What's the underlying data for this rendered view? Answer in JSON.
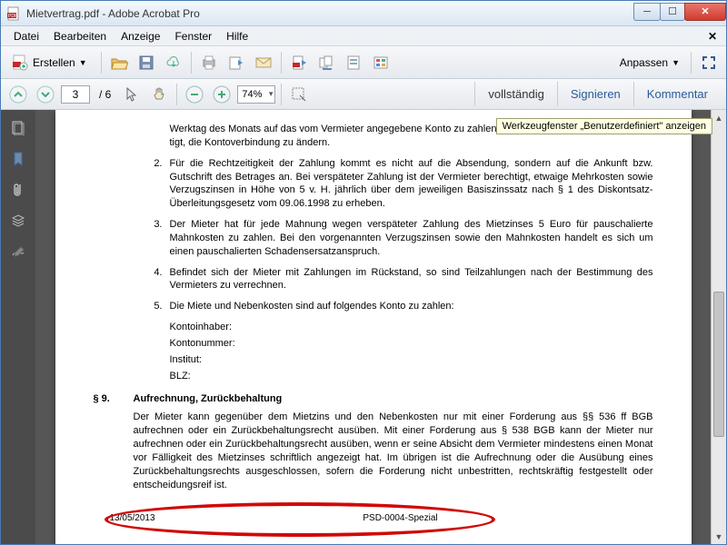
{
  "title": "Mietvertrag.pdf - Adobe Acrobat Pro",
  "menu": {
    "datei": "Datei",
    "bearbeiten": "Bearbeiten",
    "anzeige": "Anzeige",
    "fenster": "Fenster",
    "hilfe": "Hilfe"
  },
  "create": "Erstellen",
  "anpassen": "Anpassen",
  "page_current": "3",
  "page_total": "/  6",
  "zoom": "74%",
  "tabs": {
    "vollstaendig": "vollständig",
    "signieren": "Signieren",
    "kommentar": "Kommentar"
  },
  "tooltip": "Werkzeugfenster „Benutzerdefiniert\" anzeigen",
  "doc": {
    "cut": "Werktag des Monats auf das vom Vermieter angegebene Konto zu zahlen. D",
    "cut2": "tigt, die Kontoverbindung zu ändern.",
    "li2": "Für die Rechtzeitigkeit der Zahlung kommt es nicht auf die Absendung, sondern auf die Ankunft bzw. Gutschrift des Betrages an. Bei verspäteter Zahlung ist der Vermieter berechtigt, etwaige Mehrkosten sowie Verzugszinsen in Höhe von 5 v. H. jährlich über dem jeweiligen Basiszinssatz nach § 1 des Diskontsatz-Überleitungsgesetz vom 09.06.1998 zu erheben.",
    "li3": "Der Mieter hat für jede Mahnung wegen verspäteter Zahlung des Mietzinses 5 Euro für pauschalierte Mahnkosten zu zahlen. Bei den vorgenannten Verzugszinsen sowie den Mahnkosten handelt es sich um einen pauschalierten Schadensersatzanspruch.",
    "li4": "Befindet sich der Mieter mit Zahlungen im Rückstand, so sind Teilzahlungen nach der Bestimmung des Vermieters zu verrechnen.",
    "li5": "Die Miete und Nebenkosten sind auf folgendes Konto zu zahlen:",
    "bank1": "Kontoinhaber:",
    "bank2": "Kontonummer:",
    "bank3": "Institut:",
    "bank4": "BLZ:",
    "s9n": "§ 9.",
    "s9t": "Aufrechnung, Zurückbehaltung",
    "s9p": "Der Mieter kann gegenüber dem Mietzins und den Nebenkosten nur mit einer Forderung aus §§ 536 ff BGB aufrechnen oder ein Zurückbehaltungsrecht ausüben. Mit einer Forderung aus § 538 BGB kann der Mieter nur aufrechnen oder ein Zurückbehaltungsrecht ausüben, wenn er seine Absicht dem Vermieter mindestens einen Monat vor Fälligkeit des Mietzinses schriftlich angezeigt hat. Im übrigen ist die Aufrechnung oder die Ausübung eines Zurückbehaltungsrechts ausgeschlossen, sofern die Forderung nicht unbestritten, rechtskräftig festgestellt oder entscheidungsreif ist.",
    "footer_date": "13/05/2013",
    "footer_ref": "PSD-0004-Spezial"
  }
}
